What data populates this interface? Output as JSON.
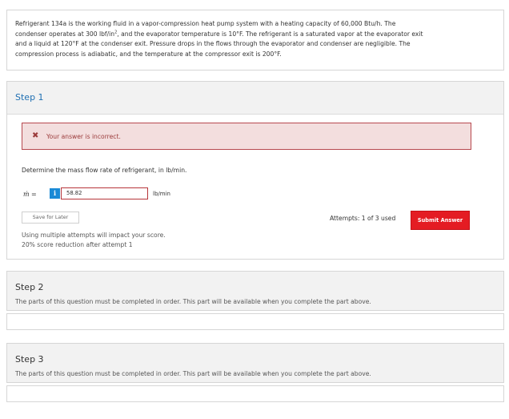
{
  "problem": {
    "text_1": "Refrigerant 134a is the working fluid in a vapor-compression heat pump system with a heating capacity of 60,000 Btu/h. The",
    "text_2a": "condenser operates at 300 lbf/in",
    "text_2sup": "2",
    "text_2b": ", and the evaporator temperature is 10°F. The refrigerant is a saturated vapor at the evaporator exit",
    "text_3": "and a liquid at 120°F at the condenser exit. Pressure drops in the flows through the evaporator and condenser are negligible. The",
    "text_4": "compression process is adiabatic, and the temperature at the compressor exit is 200°F."
  },
  "step1": {
    "title": "Step 1",
    "feedback": "Your answer is incorrect.",
    "question": "Determine the mass flow rate of refrigerant, in lb/min.",
    "variable": "ṁ",
    "equals": "=",
    "info_glyph": "i",
    "answer_value": "58.82",
    "unit": "lb/min",
    "save_label": "Save for Later",
    "attempts": "Attempts: 1 of 3 used",
    "submit_label": "Submit Answer",
    "warning_1": "Using multiple attempts will impact your score.",
    "warning_2": "20% score reduction after attempt 1"
  },
  "step2": {
    "title": "Step 2",
    "desc": "The parts of this question must be completed in order. This part will be available when you complete the part above."
  },
  "step3": {
    "title": "Step 3",
    "desc": "The parts of this question must be completed in order. This part will be available when you complete the part above."
  },
  "icons": {
    "incorrect": "x-mark-icon",
    "info": "info-icon"
  },
  "colors": {
    "accent_red": "#e41c23",
    "link_blue": "#1f6fb2",
    "error_bg": "#f3dede",
    "info_blue": "#1a8ad6"
  }
}
